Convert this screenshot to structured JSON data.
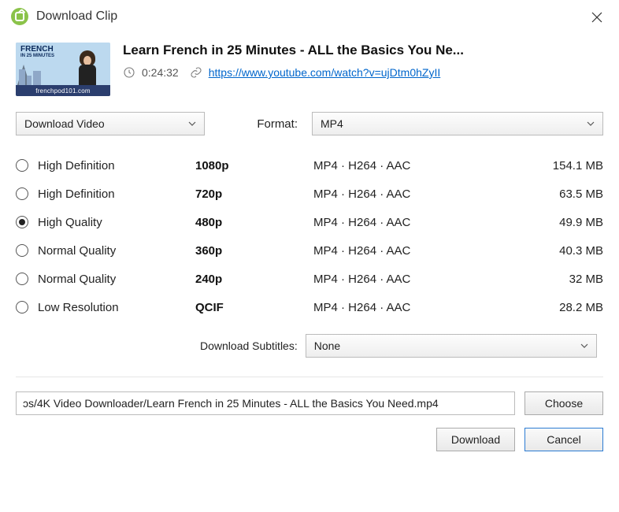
{
  "window": {
    "title": "Download Clip"
  },
  "video": {
    "title": "Learn French in 25 Minutes - ALL the Basics You Ne...",
    "duration": "0:24:32",
    "url": "https://www.youtube.com/watch?v=ujDtm0hZyII",
    "thumb_text": "FRENCH",
    "thumb_subtext": "IN 25 MINUTES",
    "thumb_band": "frenchpod101.com"
  },
  "controls": {
    "action_select": "Download Video",
    "format_label": "Format:",
    "format_select": "MP4",
    "subs_label": "Download Subtitles:",
    "subs_select": "None"
  },
  "options": [
    {
      "label": "High Definition",
      "res": "1080p",
      "codec": "MP4 · H264 · AAC",
      "size": "154.1 MB",
      "selected": false
    },
    {
      "label": "High Definition",
      "res": "720p",
      "codec": "MP4 · H264 · AAC",
      "size": "63.5 MB",
      "selected": false
    },
    {
      "label": "High Quality",
      "res": "480p",
      "codec": "MP4 · H264 · AAC",
      "size": "49.9 MB",
      "selected": true
    },
    {
      "label": "Normal Quality",
      "res": "360p",
      "codec": "MP4 · H264 · AAC",
      "size": "40.3 MB",
      "selected": false
    },
    {
      "label": "Normal Quality",
      "res": "240p",
      "codec": "MP4 · H264 · AAC",
      "size": "32 MB",
      "selected": false
    },
    {
      "label": "Low Resolution",
      "res": "QCIF",
      "codec": "MP4 · H264 · AAC",
      "size": "28.2 MB",
      "selected": false
    }
  ],
  "path": "ɔs/4K Video Downloader/Learn French in 25 Minutes - ALL the Basics You Need.mp4",
  "buttons": {
    "choose": "Choose",
    "download": "Download",
    "cancel": "Cancel"
  }
}
